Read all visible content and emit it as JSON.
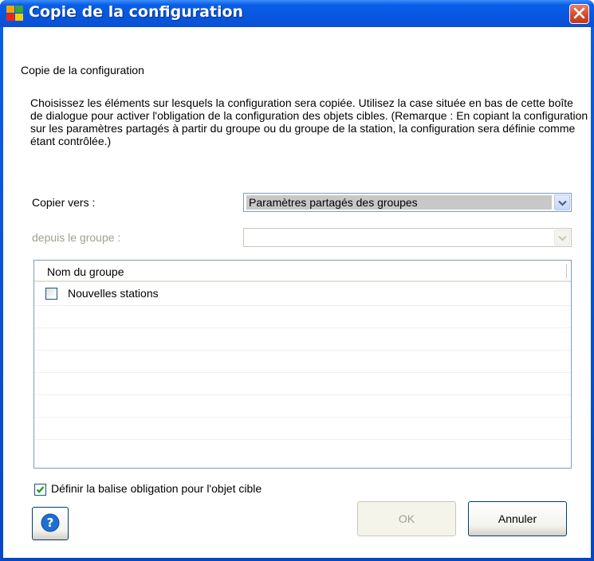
{
  "window": {
    "title": "Copie de la configuration",
    "close_icon": "close-icon",
    "app_icon": "avg-logo-icon"
  },
  "section_title": "Copie de la configuration",
  "description": "Choisissez les éléments sur lesquels la configuration sera copiée. Utilisez la case située en bas de cette boîte de dialogue pour activer l'obligation de la configuration des objets cibles. (Remarque : En copiant la configuration sur les paramètres partagés à partir du groupe ou du groupe de la station, la configuration sera définie comme étant contrôlée.)",
  "copy_to": {
    "label": "Copier vers :",
    "value": "Paramètres partagés des groupes"
  },
  "from_group": {
    "label": "depuis le groupe :",
    "value": ""
  },
  "group_list": {
    "column_header": "Nom du groupe",
    "rows": [
      {
        "label": "Nouvelles stations",
        "checked": false
      }
    ]
  },
  "enforce_checkbox": {
    "label": "Définir la balise obligation pour l'objet cible",
    "checked": true
  },
  "buttons": {
    "help_icon": "help-icon",
    "ok": "OK",
    "cancel": "Annuler"
  },
  "colors": {
    "titlebar": "#0a5fe6",
    "close_button": "#d54a2b",
    "help_button": "#1f6fd1",
    "checkmark": "#21a121"
  }
}
